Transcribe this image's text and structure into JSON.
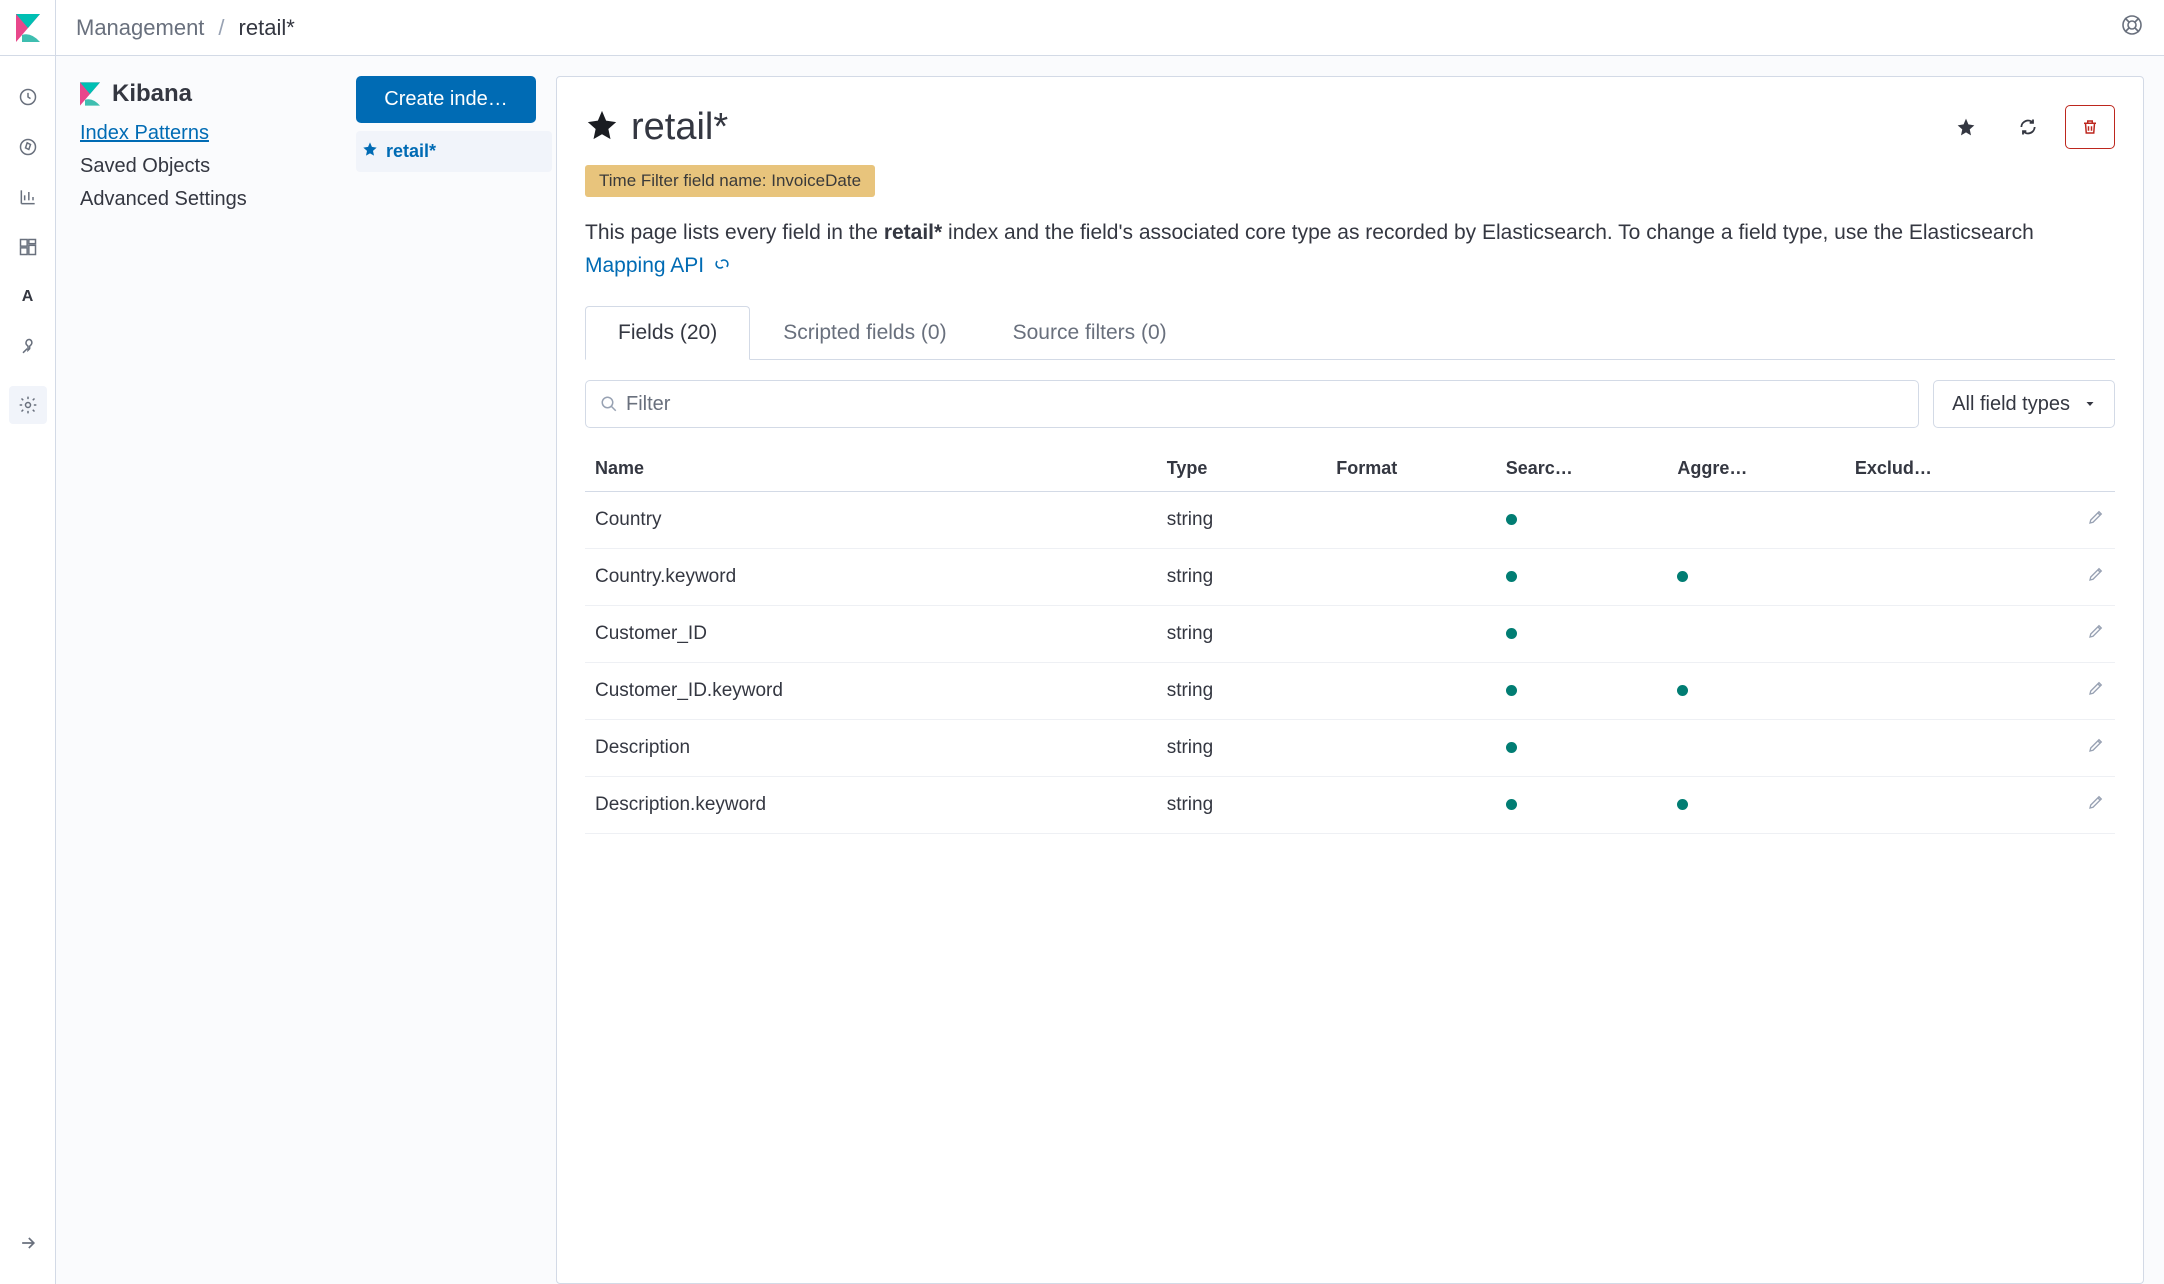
{
  "breadcrumbs": {
    "root": "Management",
    "current": "retail*"
  },
  "sidebar": {
    "title": "Kibana",
    "links": [
      "Index Patterns",
      "Saved Objects",
      "Advanced Settings"
    ]
  },
  "patternList": {
    "createLabel": "Create inde…",
    "items": [
      {
        "label": "retail*"
      }
    ]
  },
  "detail": {
    "title": "retail*",
    "timeBadge": "Time Filter field name: InvoiceDate",
    "desc_pre": "This page lists every field in the ",
    "desc_bold": "retail*",
    "desc_mid": " index and the field's associated core type as recorded by Elasticsearch. To change a field type, use the Elasticsearch ",
    "desc_link": "Mapping API",
    "tabs": [
      "Fields (20)",
      "Scripted fields (0)",
      "Source filters (0)"
    ],
    "filterPlaceholder": "Filter",
    "typeSelect": "All field types",
    "columns": [
      "Name",
      "Type",
      "Format",
      "Searc…",
      "Aggre…",
      "Exclud…"
    ],
    "rows": [
      {
        "name": "Country",
        "type": "string",
        "searchable": true,
        "aggregatable": false
      },
      {
        "name": "Country.keyword",
        "type": "string",
        "searchable": true,
        "aggregatable": true
      },
      {
        "name": "Customer_ID",
        "type": "string",
        "searchable": true,
        "aggregatable": false
      },
      {
        "name": "Customer_ID.keyword",
        "type": "string",
        "searchable": true,
        "aggregatable": true
      },
      {
        "name": "Description",
        "type": "string",
        "searchable": true,
        "aggregatable": false
      },
      {
        "name": "Description.keyword",
        "type": "string",
        "searchable": true,
        "aggregatable": true
      }
    ]
  }
}
